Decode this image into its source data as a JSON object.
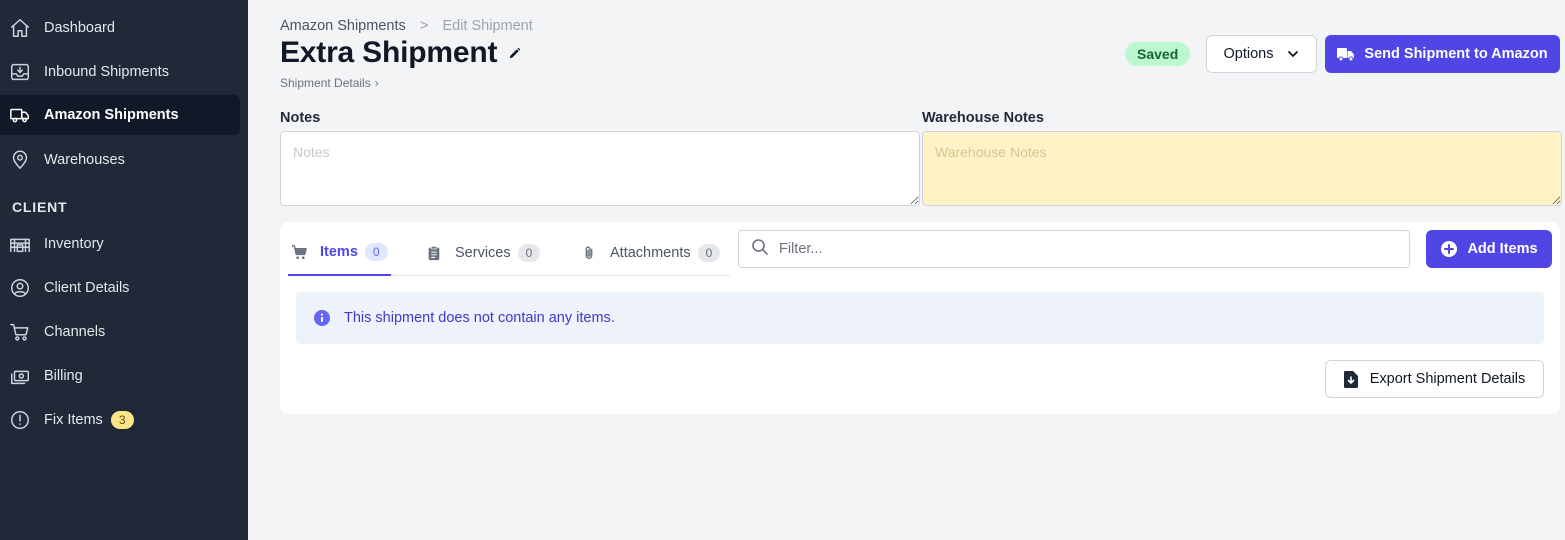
{
  "sidebar": {
    "items": [
      {
        "label": "Dashboard",
        "icon": "home-icon"
      },
      {
        "label": "Inbound Shipments",
        "icon": "inbox-download-icon"
      },
      {
        "label": "Amazon Shipments",
        "icon": "truck-icon",
        "active": true
      },
      {
        "label": "Warehouses",
        "icon": "map-pin-icon"
      }
    ],
    "section_label": "CLIENT",
    "client_items": [
      {
        "label": "Inventory",
        "icon": "warehouse-icon"
      },
      {
        "label": "Client Details",
        "icon": "user-circle-icon"
      },
      {
        "label": "Channels",
        "icon": "cart-icon"
      },
      {
        "label": "Billing",
        "icon": "cash-icon"
      },
      {
        "label": "Fix Items",
        "icon": "alert-circle-icon",
        "badge": "3"
      }
    ]
  },
  "breadcrumb": {
    "parent": "Amazon Shipments",
    "separator": ">",
    "current": "Edit Shipment"
  },
  "header": {
    "title": "Extra Shipment",
    "subtitle": "Shipment Details",
    "subtitle_chevron": "›",
    "status": "Saved",
    "options_label": "Options",
    "send_label": "Send Shipment to Amazon"
  },
  "notes": {
    "label": "Notes",
    "placeholder": "Notes",
    "value": ""
  },
  "warehouse_notes": {
    "label": "Warehouse Notes",
    "placeholder": "Warehouse Notes",
    "value": ""
  },
  "tabs": [
    {
      "label": "Items",
      "count": "0",
      "icon": "cart-icon",
      "active": true
    },
    {
      "label": "Services",
      "count": "0",
      "icon": "clipboard-icon"
    },
    {
      "label": "Attachments",
      "count": "0",
      "icon": "paperclip-icon"
    }
  ],
  "filter": {
    "placeholder": "Filter...",
    "value": ""
  },
  "add_items_label": "Add Items",
  "empty_message": "This shipment does not contain any items.",
  "export_label": "Export Shipment Details",
  "colors": {
    "sidebar_bg": "#1f2937",
    "primary": "#4f46e5",
    "saved_bg": "#bbf7d0",
    "warehouse_notes_bg": "#fef3c7",
    "alert_bg": "#eef2fb",
    "badge_yellow": "#fde68a"
  }
}
